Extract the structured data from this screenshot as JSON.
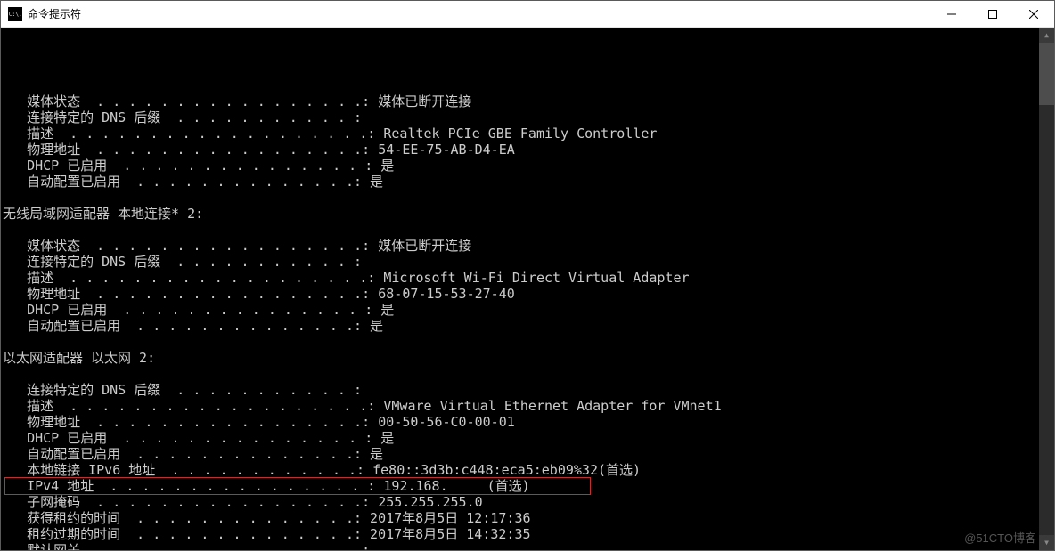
{
  "window": {
    "title": "命令提示符",
    "icon_label": "C:\\."
  },
  "blocks": [
    {
      "header": "",
      "rows": [
        {
          "label": "   媒体状态",
          "value": "媒体已断开连接"
        },
        {
          "label": "   连接特定的 DNS 后缀",
          "value": ""
        },
        {
          "label": "   描述",
          "value": "Realtek PCIe GBE Family Controller"
        },
        {
          "label": "   物理地址",
          "value": "54-EE-75-AB-D4-EA"
        },
        {
          "label": "   DHCP 已启用",
          "value": "是"
        },
        {
          "label": "   自动配置已启用",
          "value": "是"
        }
      ]
    },
    {
      "header": "无线局域网适配器 本地连接* 2:",
      "rows": [
        {
          "label": "   媒体状态",
          "value": "媒体已断开连接"
        },
        {
          "label": "   连接特定的 DNS 后缀",
          "value": ""
        },
        {
          "label": "   描述",
          "value": "Microsoft Wi-Fi Direct Virtual Adapter"
        },
        {
          "label": "   物理地址",
          "value": "68-07-15-53-27-40"
        },
        {
          "label": "   DHCP 已启用",
          "value": "是"
        },
        {
          "label": "   自动配置已启用",
          "value": "是"
        }
      ]
    },
    {
      "header": "以太网适配器 以太网 2:",
      "rows": [
        {
          "label": "   连接特定的 DNS 后缀",
          "value": ""
        },
        {
          "label": "   描述",
          "value": "VMware Virtual Ethernet Adapter for VMnet1"
        },
        {
          "label": "   物理地址",
          "value": "00-50-56-C0-00-01"
        },
        {
          "label": "   DHCP 已启用",
          "value": "是"
        },
        {
          "label": "   自动配置已启用",
          "value": "是"
        },
        {
          "label": "   本地链接 IPv6 地址",
          "value": "fe80::3d3b:c448:eca5:eb09%32(首选)"
        },
        {
          "label": "   IPv4 地址",
          "value": "192.168.",
          "value_suffix": "(首选)",
          "redacted": true,
          "highlighted": true
        },
        {
          "label": "   子网掩码",
          "value": "255.255.255.0"
        },
        {
          "label": "   获得租约的时间",
          "value": "2017年8月5日 12:17:36"
        },
        {
          "label": "   租约过期的时间",
          "value": "2017年8月5日 14:32:35"
        },
        {
          "label": "   默认网关",
          "value": ""
        }
      ]
    }
  ],
  "watermark": "@51CTO博客",
  "layout": {
    "value_col": 48
  }
}
